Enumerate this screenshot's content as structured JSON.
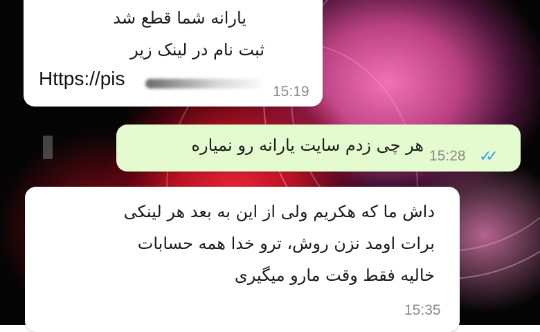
{
  "colors": {
    "incoming_bubble": "#ffffff",
    "outgoing_bubble": "#e4fbcf",
    "timestamp": "#8a8a8a",
    "read_ticks": "#3d9be9"
  },
  "messages": [
    {
      "direction": "incoming",
      "lines": [
        "یارانه شما قطع شد",
        "ثبت نام در لینک زیر"
      ],
      "link_text": "Https://pis",
      "link_rest_obscured": true,
      "time": "15:19"
    },
    {
      "direction": "outgoing",
      "lines": [
        "هر چی زدم سایت یارانه رو نمیاره"
      ],
      "time": "15:28",
      "status_icon": "double-check-read-icon",
      "status_glyph": "✓✓"
    },
    {
      "direction": "incoming",
      "lines": [
        "داش ما که هکریم ولی از این به بعد هر لینکی",
        "برات اومد نزن روش، ترو خدا همه حسابات",
        "خالیه فقط وقت مارو میگیری"
      ],
      "time": "15:35"
    }
  ]
}
